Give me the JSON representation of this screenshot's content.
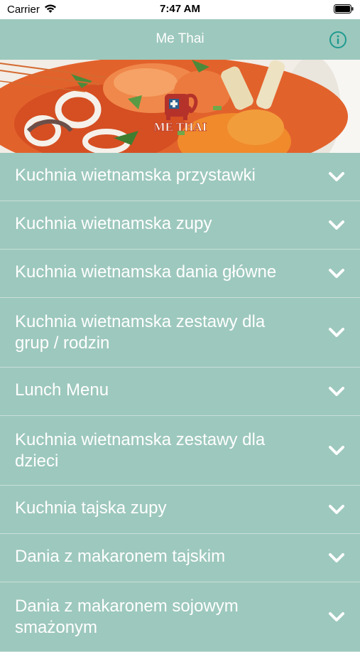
{
  "status_bar": {
    "carrier": "Carrier",
    "time": "7:47 AM"
  },
  "nav": {
    "title": "Me Thai",
    "info_icon": "info-circle-icon"
  },
  "hero": {
    "logo_text": "ME THAI"
  },
  "menu": {
    "items": [
      {
        "label": "Kuchnia wietnamska przystawki"
      },
      {
        "label": "Kuchnia wietnamska zupy"
      },
      {
        "label": "Kuchnia wietnamska dania główne"
      },
      {
        "label": "Kuchnia wietnamska zestawy dla grup / rodzin"
      },
      {
        "label": "Lunch Menu"
      },
      {
        "label": "Kuchnia wietnamska zestawy dla dzieci"
      },
      {
        "label": "Kuchnia tajska zupy"
      },
      {
        "label": "Dania z makaronem tajskim"
      },
      {
        "label": "Dania z makaronem sojowym smażonym"
      }
    ]
  },
  "colors": {
    "background": "#9dc8bd",
    "info_accent": "#1f9a8f",
    "logo_red": "#b5322a"
  }
}
